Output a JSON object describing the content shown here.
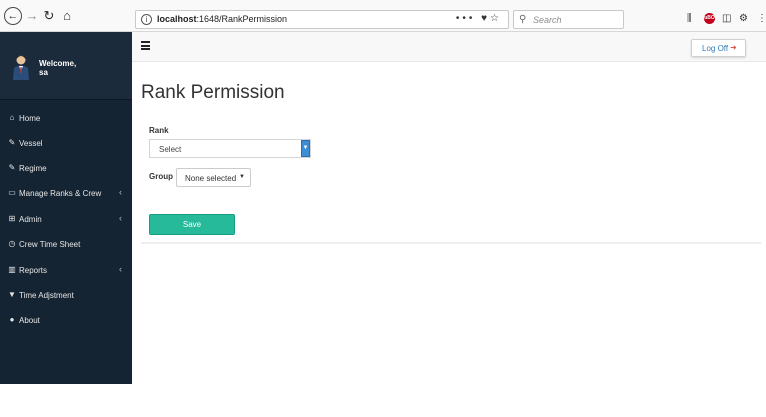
{
  "browser": {
    "url_host": "localhost",
    "url_rest": ":1648/RankPermission",
    "url_actions": "••• ",
    "search_placeholder": "Search",
    "ublock_label": "uBO"
  },
  "sidebar": {
    "welcome": "Welcome,",
    "username": "sa",
    "items": [
      {
        "label": "Home",
        "icon": "home-icon",
        "glyph": "⌂",
        "caret": ""
      },
      {
        "label": "Vessel",
        "icon": "edit-icon",
        "glyph": "✎",
        "caret": ""
      },
      {
        "label": "Regime",
        "icon": "pencil-icon",
        "glyph": "✎",
        "caret": ""
      },
      {
        "label": "Manage Ranks & Crew",
        "icon": "desktop-icon",
        "glyph": "▭",
        "caret": "‹"
      },
      {
        "label": "Admin",
        "icon": "table-icon",
        "glyph": "⊞",
        "caret": "‹"
      },
      {
        "label": "Crew Time Sheet",
        "icon": "clock-icon",
        "glyph": "◷",
        "caret": ""
      },
      {
        "label": "Reports",
        "icon": "bar-chart-icon",
        "glyph": "▥",
        "caret": "‹"
      },
      {
        "label": "Time Adjstment",
        "icon": "filter-icon",
        "glyph": "▼",
        "caret": ""
      },
      {
        "label": "About",
        "icon": "user-icon",
        "glyph": "●",
        "caret": ""
      }
    ]
  },
  "topnav": {
    "logoff_label": "Log Off"
  },
  "main": {
    "title": "Rank Permission",
    "rank_label": "Rank",
    "rank_value": "Select",
    "group_label": "Group",
    "group_value": "None selected",
    "save_label": "Save"
  },
  "colors": {
    "sidebar_bg": "#152432",
    "save_button": "#26b99a",
    "select_arrow": "#3d8ed6",
    "logoff_text": "#337ab7"
  }
}
